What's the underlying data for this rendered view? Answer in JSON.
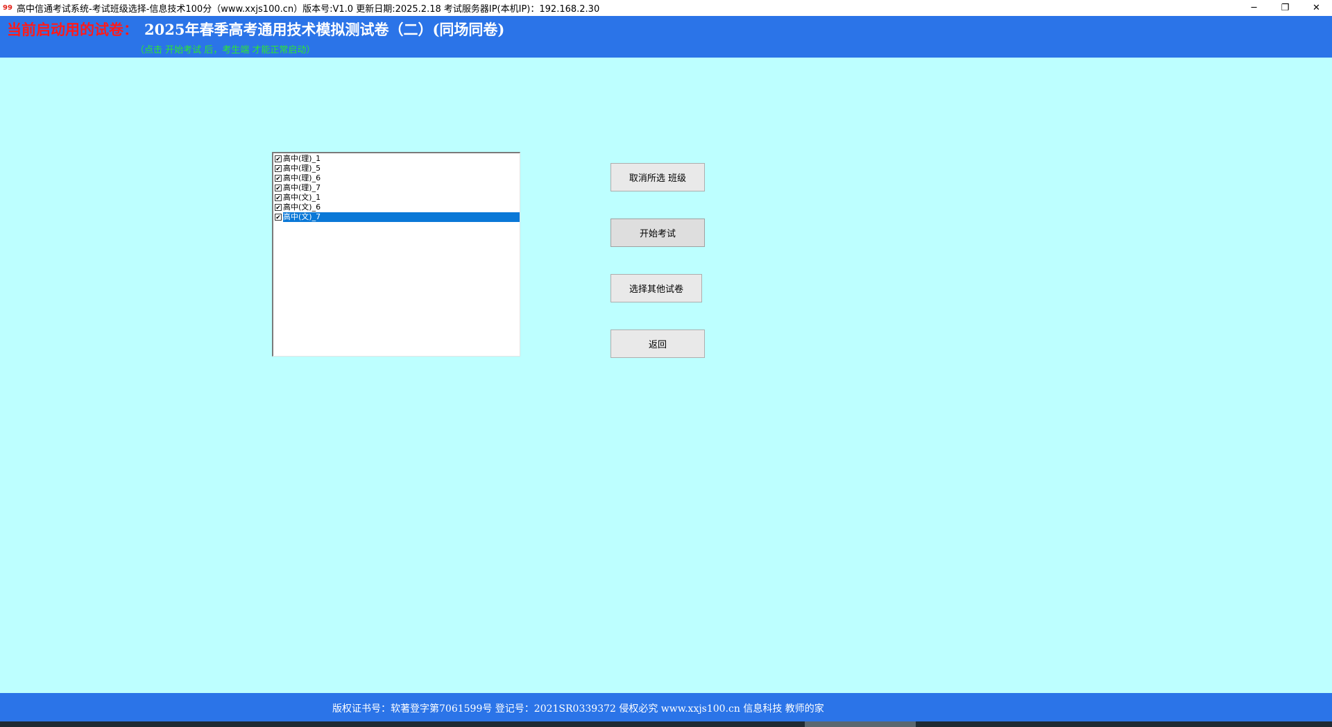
{
  "window": {
    "title": "高中信通考试系统-考试班级选择-信息技术100分（www.xxjs100.cn）版本号:V1.0 更新日期:2025.2.18    考试服务器IP(本机IP)：192.168.2.30",
    "icon": "app-logo-icon",
    "minimize_glyph": "─",
    "restore_glyph": "❐",
    "close_glyph": "✕"
  },
  "header": {
    "label": "当前启动用的试卷：",
    "exam_title": "2025年春季高考通用技术模拟测试卷（二）(同场同卷)",
    "hint": "（点击 开始考试 后，考生端 才能正常启动）"
  },
  "class_list": {
    "items": [
      {
        "label": "高中(理)_1",
        "checked": true,
        "selected": false
      },
      {
        "label": "高中(理)_5",
        "checked": true,
        "selected": false
      },
      {
        "label": "高中(理)_6",
        "checked": true,
        "selected": false
      },
      {
        "label": "高中(理)_7",
        "checked": true,
        "selected": false
      },
      {
        "label": "高中(文)_1",
        "checked": true,
        "selected": false
      },
      {
        "label": "高中(文)_6",
        "checked": true,
        "selected": false
      },
      {
        "label": "高中(文)_7",
        "checked": true,
        "selected": true
      }
    ]
  },
  "buttons": {
    "deselect": "取消所选 班级",
    "start": "开始考试",
    "choose_other": "选择其他试卷",
    "back": "返回"
  },
  "footer": {
    "text": "版权证书号：软著登字第7061599号 登记号：2021SR0339372  侵权必究  www.xxjs100.cn  信息科技 教师的家"
  },
  "colors": {
    "background": "#bdffff",
    "header_blue": "#2b74e8",
    "label_red": "#ff1a1a",
    "hint_green": "#2ee82e",
    "selection_blue": "#0a78d7"
  }
}
